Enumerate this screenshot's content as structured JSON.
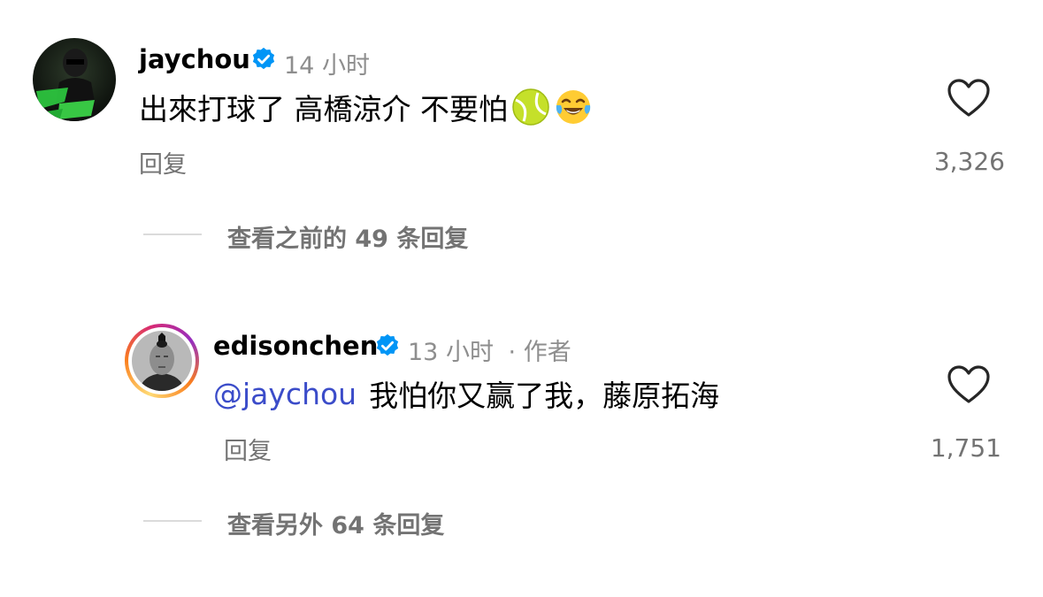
{
  "comments": [
    {
      "username": "jaychou",
      "time": "14 小时",
      "text": "出來打球了 高橋涼介 不要怕",
      "emojis": [
        "tennis-ball-emoji",
        "tears-of-joy-emoji"
      ],
      "reply_label": "回复",
      "likes": "3,326",
      "view_replies": "查看之前的 49 条回复"
    },
    {
      "username": "edisonchen",
      "time": "13 小时",
      "author_tag": "· 作者",
      "mention": "@jaychou",
      "text": "我怕你又赢了我，藤原拓海",
      "reply_label": "回复",
      "likes": "1,751",
      "view_replies": "查看另外 64 条回复"
    }
  ],
  "colors": {
    "verified": "#0095f6",
    "mention": "#3b4cc9",
    "meta": "#8e8e8e",
    "secondary": "#737373"
  }
}
